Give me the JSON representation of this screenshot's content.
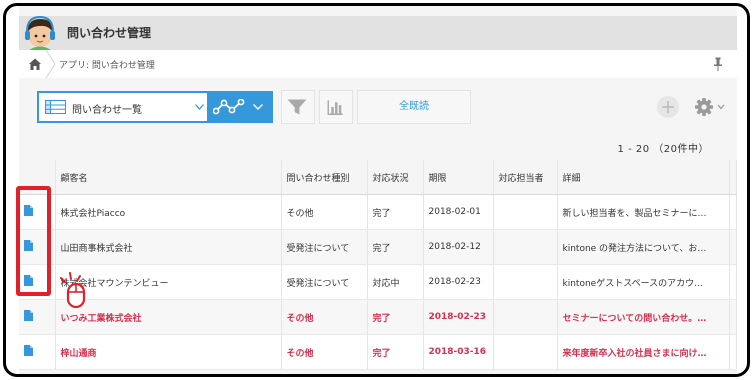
{
  "app": {
    "title": "問い合わせ管理"
  },
  "breadcrumb": {
    "text": "アプリ: 問い合わせ管理"
  },
  "toolbar": {
    "view_name": "問い合わせ一覧",
    "mark_read_label": "全既読"
  },
  "pagination": {
    "text": "1 - 20 （20件中）"
  },
  "table": {
    "headers": [
      "",
      "顧客名",
      "問い合わせ種別",
      "対応状況",
      "期限",
      "対応担当者",
      "詳細"
    ],
    "rows": [
      {
        "customer": "株式会社Piacco",
        "type": "その他",
        "status": "完了",
        "due": "2018-02-01",
        "assignee": "",
        "detail": "新しい担当者を、製品セミナーに…",
        "highlighted": false
      },
      {
        "customer": "山田商事株式会社",
        "type": "受発注について",
        "status": "完了",
        "due": "2018-02-12",
        "assignee": "",
        "detail": "kintone の発注方法について、お…",
        "highlighted": false
      },
      {
        "customer": "株式会社マウンテンビュー",
        "type": "受発注について",
        "status": "対応中",
        "due": "2018-02-23",
        "assignee": "",
        "detail": "kintoneゲストスペースのアカウ…",
        "highlighted": false
      },
      {
        "customer": "いつみ工業株式会社",
        "type": "その他",
        "status": "完了",
        "due": "2018-02-23",
        "assignee": "",
        "detail": "セミナーについての問い合わせ。…",
        "highlighted": true
      },
      {
        "customer": "梓山通商",
        "type": "その他",
        "status": "完了",
        "due": "2018-03-16",
        "assignee": "",
        "detail": "来年度新卒入社の社員さまに向け…",
        "highlighted": true
      }
    ]
  },
  "colors": {
    "accent": "#3498db",
    "highlight_text": "#d6304d",
    "annotation": "#e0202a"
  },
  "icons": [
    "avatar",
    "home-icon",
    "pin-icon",
    "list-icon",
    "graph-icon",
    "filter-icon",
    "bar-chart-icon",
    "plus-icon",
    "gear-icon",
    "document-icon",
    "click-indicator"
  ]
}
